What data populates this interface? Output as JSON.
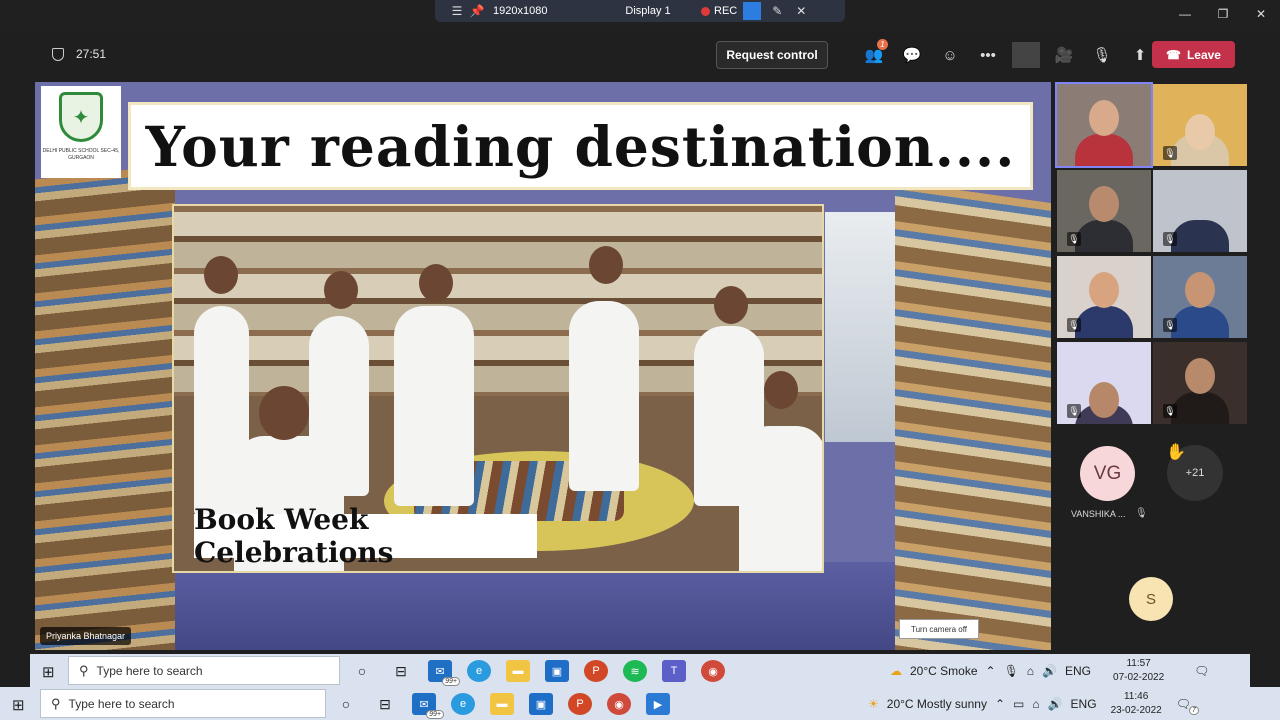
{
  "share_bar": {
    "resolution": "1920x1080",
    "display": "Display 1",
    "rec": "REC"
  },
  "toolbar": {
    "timer": "27:51",
    "request_control": "Request control",
    "leave": "Leave",
    "chat_badge": "1"
  },
  "slide": {
    "title": "Your reading destination....",
    "caption": "Book Week Celebrations",
    "camera_label": "Turn camera off",
    "school_logo_text": "DELHI PUBLIC SCHOOL SEC-45, GURGAON"
  },
  "presenter_name": "Priyanka Bhatnagar",
  "participants": {
    "vg_initials": "VG",
    "vg_name": "VANSHIKA ...",
    "more_count": "+21",
    "s_initials": "S"
  },
  "taskbar1": {
    "search_placeholder": "Type here to search",
    "mail_badge": "99+",
    "weather": "20°C  Smoke",
    "lang": "ENG",
    "time": "11:57",
    "date": "07-02-2022"
  },
  "taskbar2": {
    "search_placeholder": "Type here to search",
    "mail_badge": "99+",
    "weather": "20°C  Mostly sunny",
    "lang": "ENG",
    "time": "11:46",
    "date": "23-02-2022",
    "notif_count": "7"
  },
  "colors": {
    "leave_red": "#c4314b",
    "teams_purple": "#7f85f5",
    "taskbar": "#d9e2ee"
  }
}
